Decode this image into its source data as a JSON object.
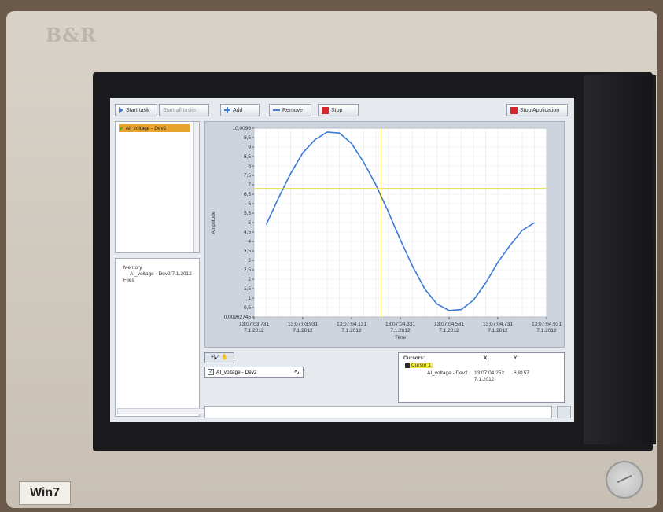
{
  "device": {
    "brand": "B&R",
    "os_badge": "Win7"
  },
  "toolbar": {
    "start_task": "Start task",
    "start_all": "Start all tasks",
    "add": "Add",
    "remove": "Remove",
    "stop": "Stop",
    "stop_app": "Stop Application"
  },
  "tree": {
    "item": "AI_voltage - Dev2"
  },
  "files": {
    "memory": "Memory",
    "entry": "AI_voltage - Dev2/7.1.2012",
    "files": "Files"
  },
  "palette": {
    "label": "+|⤢ ✋"
  },
  "legend": {
    "check": "✓",
    "name": "AI_voltage - Dev2"
  },
  "cursors": {
    "headers": [
      "Cursors:",
      "X",
      "Y"
    ],
    "cursor_name": "Cursor 1",
    "row": {
      "channel": "AI_voltage - Dev2",
      "x_time": "13:07:04,252",
      "x_date": "7.1.2012",
      "y": "6,8157"
    }
  },
  "chart_data": {
    "type": "line",
    "ylabel": "Amplitude",
    "xlabel": "Time",
    "ylim": [
      0.00962745,
      10.0096
    ],
    "yticks": [
      "10,0096",
      "9,5",
      "9",
      "8,5",
      "8",
      "7,5",
      "7",
      "6,5",
      "6",
      "5,5",
      "5",
      "4,5",
      "4",
      "3,5",
      "3",
      "2,5",
      "2",
      "1,5",
      "1",
      "0,5",
      "0,00962745"
    ],
    "xticks": [
      {
        "time": "13:07:03,731",
        "date": "7.1.2012"
      },
      {
        "time": "13:07:03,931",
        "date": "7.1.2012"
      },
      {
        "time": "13:07:04,131",
        "date": "7.1.2012"
      },
      {
        "time": "13:07:04,331",
        "date": "7.1.2012"
      },
      {
        "time": "13:07:04,531",
        "date": "7.1.2012"
      },
      {
        "time": "13:07:04,731",
        "date": "7.1.2012"
      },
      {
        "time": "13:07:04,931",
        "date": "7.1.2012"
      }
    ],
    "series": [
      {
        "color": "#3a78d8",
        "t": [
          0.05,
          0.1,
          0.15,
          0.2,
          0.25,
          0.3,
          0.35,
          0.4,
          0.45,
          0.5,
          0.55,
          0.6,
          0.65,
          0.7,
          0.75,
          0.8,
          0.85,
          0.9,
          0.95,
          1.0,
          1.05,
          1.1,
          1.15
        ],
        "y": [
          4.9,
          6.3,
          7.6,
          8.7,
          9.4,
          9.8,
          9.75,
          9.2,
          8.2,
          7.0,
          5.6,
          4.1,
          2.7,
          1.5,
          0.7,
          0.35,
          0.4,
          0.9,
          1.8,
          2.9,
          3.8,
          4.6,
          5.0
        ]
      }
    ],
    "cursor": {
      "t": 0.521,
      "y": 6.8157
    },
    "grid": true
  }
}
